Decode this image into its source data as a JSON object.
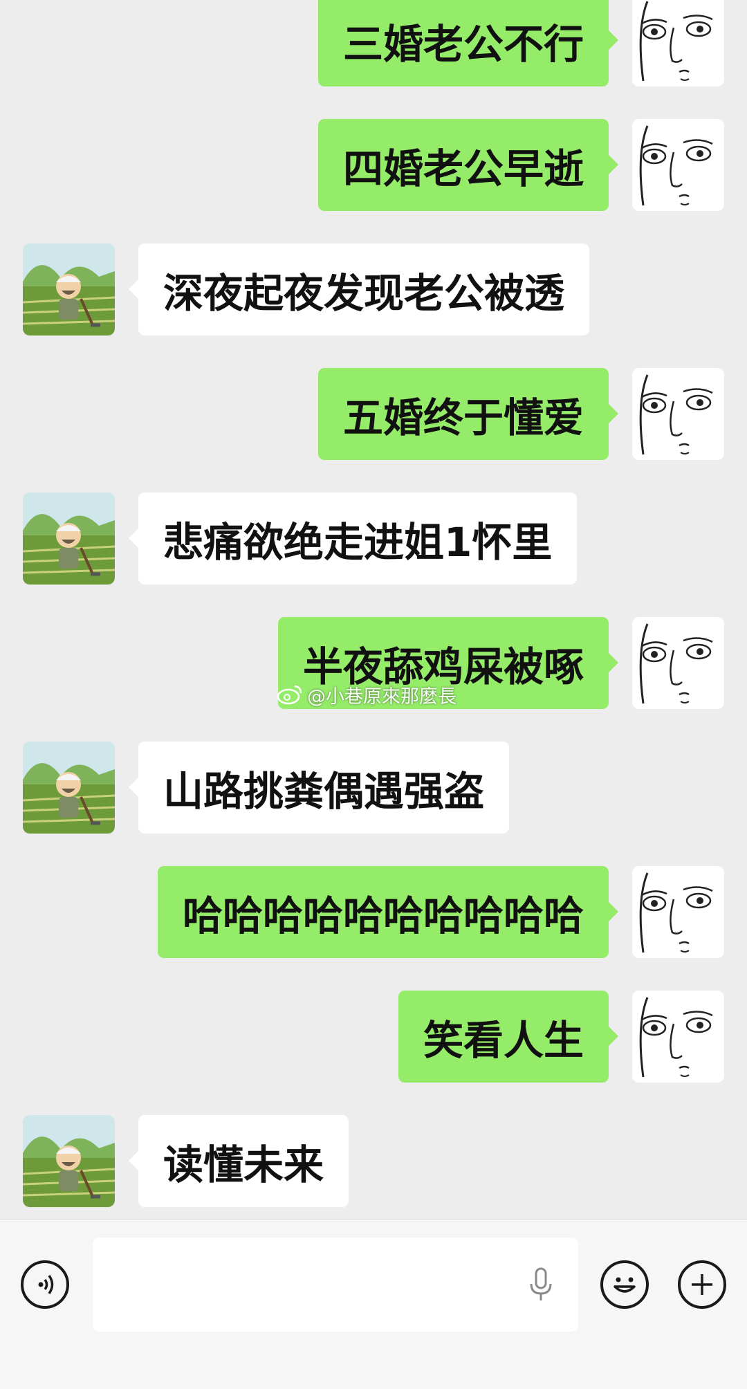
{
  "conversation": {
    "messages": [
      {
        "side": "right",
        "text": "三婚老公不行"
      },
      {
        "side": "right",
        "text": "四婚老公早逝"
      },
      {
        "side": "left",
        "text": "深夜起夜发现老公被透"
      },
      {
        "side": "right",
        "text": "五婚终于懂爱"
      },
      {
        "side": "left",
        "text": "悲痛欲绝走进姐1怀里"
      },
      {
        "side": "right",
        "text": "半夜舔鸡屎被啄"
      },
      {
        "side": "left",
        "text": "山路挑粪偶遇强盗"
      },
      {
        "side": "right",
        "text": "哈哈哈哈哈哈哈哈哈哈"
      },
      {
        "side": "right",
        "text": "笑看人生"
      },
      {
        "side": "left",
        "text": "读懂未来"
      }
    ]
  },
  "watermark": {
    "text": "@小巷原來那麼長",
    "icon": "weibo-icon"
  },
  "input_bar": {
    "voice_icon": "voice-mode-icon",
    "mic_icon": "microphone-icon",
    "emoji_icon": "emoji-icon",
    "plus_icon": "plus-icon"
  },
  "colors": {
    "background": "#ededed",
    "sent_bubble": "#95ec69",
    "received_bubble": "#ffffff",
    "input_bar": "#f6f6f6"
  }
}
